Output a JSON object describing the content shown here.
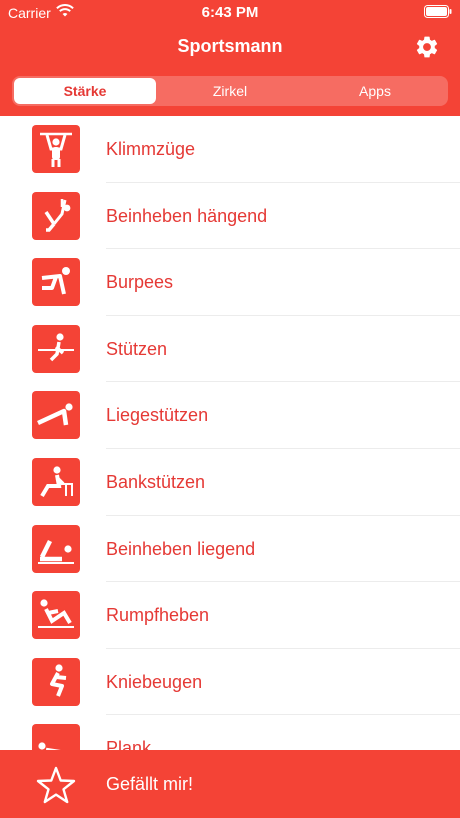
{
  "status_bar": {
    "carrier": "Carrier",
    "time": "6:43 PM",
    "icons": [
      "wifi-icon",
      "battery-icon"
    ]
  },
  "nav": {
    "title": "Sportsmann",
    "settings_icon": "gear-icon"
  },
  "segments": [
    {
      "label": "Stärke",
      "selected": true
    },
    {
      "label": "Zirkel",
      "selected": false
    },
    {
      "label": "Apps",
      "selected": false
    }
  ],
  "exercises": [
    {
      "label": "Klimmzüge",
      "icon": "pullup-icon"
    },
    {
      "label": "Beinheben hängend",
      "icon": "hanging-leg-raise-icon"
    },
    {
      "label": "Burpees",
      "icon": "burpee-icon"
    },
    {
      "label": "Stützen",
      "icon": "dip-icon"
    },
    {
      "label": "Liegestützen",
      "icon": "pushup-icon"
    },
    {
      "label": "Bankstützen",
      "icon": "bench-dip-icon"
    },
    {
      "label": "Beinheben liegend",
      "icon": "lying-leg-raise-icon"
    },
    {
      "label": "Rumpfheben",
      "icon": "situp-icon"
    },
    {
      "label": "Kniebeugen",
      "icon": "squat-icon"
    },
    {
      "label": "Plank",
      "icon": "plank-icon"
    }
  ],
  "footer": {
    "label": "Gefällt mir!",
    "icon": "star-icon"
  },
  "colors": {
    "primary": "#f44336",
    "accent_text": "#e53935",
    "background": "#ffffff"
  }
}
